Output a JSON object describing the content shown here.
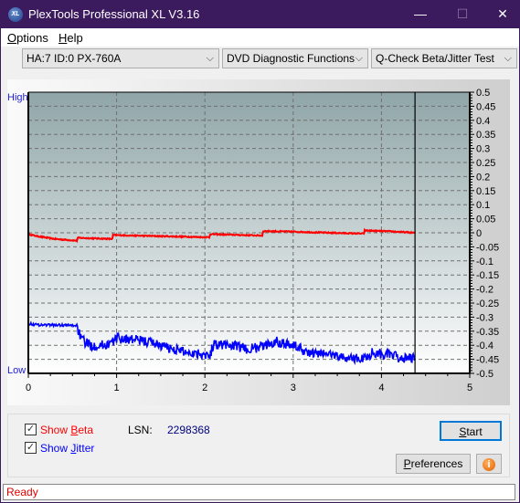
{
  "window": {
    "title": "PlexTools Professional XL V3.16",
    "logo_text": "XL",
    "minimize": "—",
    "maximize": "☐",
    "close": "✕"
  },
  "menu": {
    "items": [
      {
        "label": "Options",
        "accel": "O",
        "rest": "ptions"
      },
      {
        "label": "Help",
        "accel": "H",
        "rest": "elp"
      }
    ]
  },
  "toolbar": {
    "drive": "HA:7 ID:0  PX-760A",
    "function": "DVD Diagnostic Functions",
    "test": "Q-Check Beta/Jitter Test",
    "arrow": "⌵"
  },
  "chart_labels": {
    "high": "High",
    "low": "Low"
  },
  "chart_data": {
    "type": "line",
    "title": "",
    "xlabel": "",
    "ylabel": "",
    "xlim": [
      0,
      5
    ],
    "ylim": [
      -0.5,
      0.5
    ],
    "x_ticks": [
      "0",
      "1",
      "2",
      "3",
      "4",
      "5"
    ],
    "y_ticks": [
      "0.5",
      "0.45",
      "0.4",
      "0.35",
      "0.3",
      "0.25",
      "0.2",
      "0.15",
      "0.1",
      "0.05",
      "0",
      "-0.05",
      "-0.1",
      "-0.15",
      "-0.2",
      "-0.25",
      "-0.3",
      "-0.35",
      "-0.4",
      "-0.45",
      "-0.5"
    ],
    "grid": true,
    "end_marker_x": 4.38,
    "series": [
      {
        "name": "Beta",
        "color": "#ff0000",
        "x": [
          0,
          0.1,
          0.3,
          0.55,
          0.56,
          0.95,
          0.96,
          1.2,
          1.5,
          2.05,
          2.06,
          2.3,
          2.65,
          2.66,
          3.0,
          3.4,
          3.8,
          3.81,
          4.1,
          4.38
        ],
        "y": [
          -0.005,
          -0.012,
          -0.022,
          -0.028,
          -0.018,
          -0.022,
          -0.008,
          -0.01,
          -0.012,
          -0.016,
          -0.005,
          -0.007,
          -0.01,
          0.006,
          0.004,
          0.0,
          -0.003,
          0.008,
          0.005,
          0.0
        ]
      },
      {
        "name": "Jitter",
        "color": "#0000ff",
        "x": [
          0,
          0.1,
          0.3,
          0.55,
          0.6,
          0.7,
          0.85,
          0.95,
          1.0,
          1.2,
          1.4,
          1.6,
          1.8,
          2.0,
          2.05,
          2.1,
          2.3,
          2.5,
          2.7,
          2.8,
          3.0,
          3.2,
          3.4,
          3.6,
          3.8,
          3.9,
          4.1,
          4.2,
          4.38
        ],
        "y": [
          -0.323,
          -0.327,
          -0.328,
          -0.33,
          -0.38,
          -0.4,
          -0.4,
          -0.39,
          -0.375,
          -0.38,
          -0.39,
          -0.41,
          -0.425,
          -0.43,
          -0.44,
          -0.395,
          -0.4,
          -0.415,
          -0.4,
          -0.385,
          -0.4,
          -0.43,
          -0.43,
          -0.445,
          -0.448,
          -0.425,
          -0.435,
          -0.445,
          -0.448
        ]
      }
    ]
  },
  "controls": {
    "show_beta": {
      "label": "Show Beta",
      "pre": "Show ",
      "accel": "B",
      "rest": "eta",
      "checked": true,
      "color": "#ff0000"
    },
    "show_jitter": {
      "label": "Show Jitter",
      "pre": "Show ",
      "accel": "J",
      "rest": "itter",
      "checked": true,
      "color": "#0000ff"
    },
    "lsn_label": "LSN:",
    "lsn_value": "2298368",
    "start": {
      "label": "Start",
      "accel": "S",
      "rest": "tart"
    },
    "preferences": {
      "label": "Preferences",
      "accel": "P",
      "rest": "references"
    },
    "info_icon": "i"
  },
  "status": {
    "text": "Ready"
  }
}
